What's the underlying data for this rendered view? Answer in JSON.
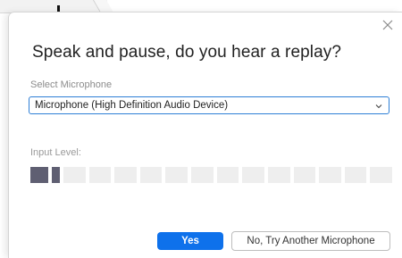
{
  "dialog": {
    "title": "Speak and pause, do you hear a replay?",
    "close_icon": "close-icon"
  },
  "microphone": {
    "label": "Select Microphone",
    "selected": "Microphone (High Definition Audio Device)",
    "chevron_icon": "chevron-down-icon"
  },
  "input_level": {
    "label": "Input Level:",
    "segments_total": 15,
    "segments_active": 2
  },
  "buttons": {
    "yes": "Yes",
    "try_another": "No, Try Another Microphone"
  },
  "colors": {
    "accent": "#0e71eb",
    "select_border": "#2e7fd6",
    "meter_active": "#5f5f72",
    "meter_inactive": "#eeeeee"
  }
}
